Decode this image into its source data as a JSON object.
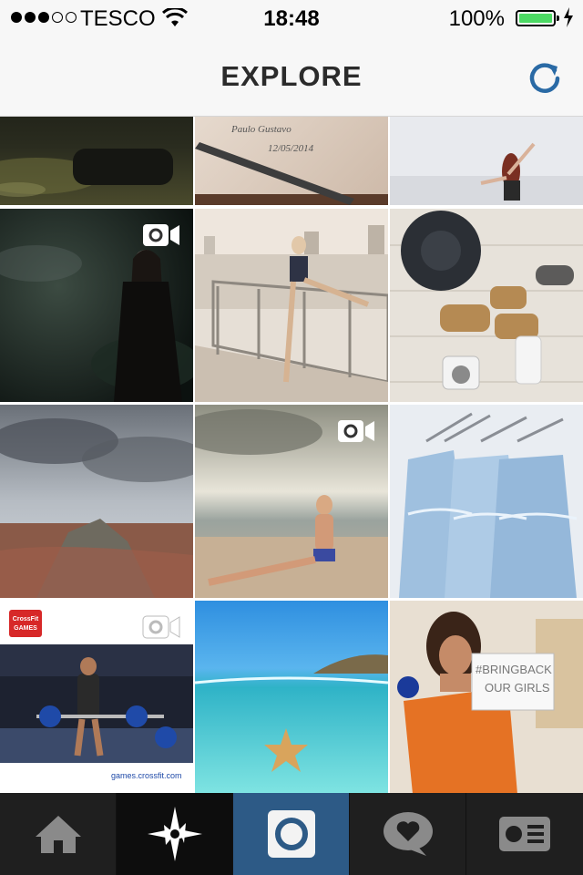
{
  "status_bar": {
    "carrier": "TESCO",
    "time": "18:48",
    "battery": "100%",
    "signal_bars_filled": 3,
    "signal_bars_total": 5
  },
  "nav": {
    "title": "EXPLORE",
    "refresh_icon": "refresh-icon"
  },
  "grid": {
    "tiles": [
      {
        "name": "night-street-photo",
        "video": false
      },
      {
        "name": "signed-notebook-photo",
        "text": "Paulo Gustavo 12/05/2014",
        "video": false
      },
      {
        "name": "woman-jumping-photo",
        "video": false
      },
      {
        "name": "woman-in-dark-woods-photo",
        "video": true
      },
      {
        "name": "ballerina-on-pier-photo",
        "video": false
      },
      {
        "name": "hat-and-shoes-flatlay-photo",
        "video": false
      },
      {
        "name": "mountain-landscape-photo",
        "video": false
      },
      {
        "name": "yoga-on-beach-photo",
        "video": true
      },
      {
        "name": "blue-lace-dresses-photo",
        "video": false
      },
      {
        "name": "crossfit-games-photo",
        "text": "games.crossfit.com",
        "logo_text": "Reebok CrossFit GAMES 2014",
        "video": true
      },
      {
        "name": "starfish-underwater-photo",
        "video": false
      },
      {
        "name": "bring-back-our-girls-photo",
        "text": "#BRINGBACK OUR GIRLS",
        "video": false
      }
    ]
  },
  "tab_bar": {
    "tabs": [
      {
        "name": "home",
        "icon": "home-icon"
      },
      {
        "name": "explore",
        "icon": "compass-star-icon"
      },
      {
        "name": "camera",
        "icon": "camera-icon"
      },
      {
        "name": "activity",
        "icon": "heart-bubble-icon"
      },
      {
        "name": "profile",
        "icon": "profile-card-icon"
      }
    ]
  },
  "colors": {
    "accent_blue": "#2d5a86",
    "refresh_blue": "#2a6aa5",
    "battery_green": "#4cd964"
  }
}
